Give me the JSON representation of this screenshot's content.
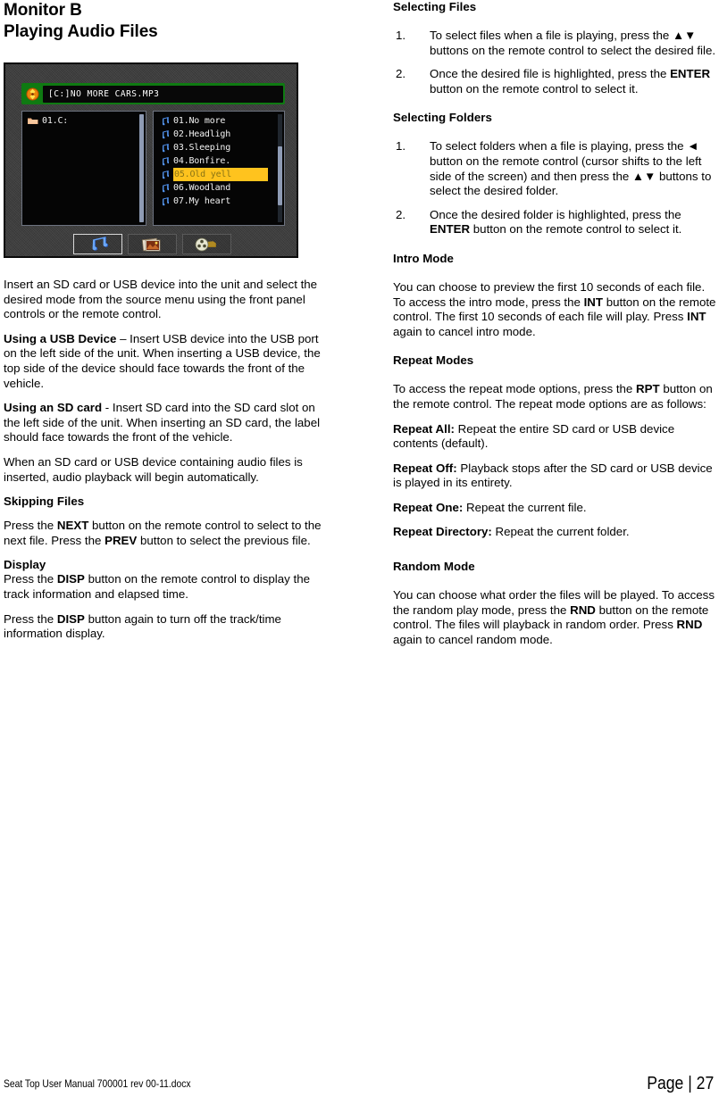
{
  "document": {
    "heading_line1": "Monitor B",
    "heading_line2": "Playing Audio Files"
  },
  "device_screenshot": {
    "now_playing": "[C:]NO MORE CARS.MP3",
    "disc_icon": "disc-icon",
    "folder_pane": {
      "rows": [
        {
          "icon": "folder-icon",
          "label": "01.C:"
        }
      ]
    },
    "file_pane": {
      "rows": [
        {
          "icon": "music-note-icon",
          "label": "01.No more",
          "selected": false
        },
        {
          "icon": "music-note-icon",
          "label": "02.Headligh",
          "selected": false
        },
        {
          "icon": "music-note-icon",
          "label": "03.Sleeping",
          "selected": false
        },
        {
          "icon": "music-note-icon",
          "label": "04.Bonfire.",
          "selected": false
        },
        {
          "icon": "music-note-icon",
          "label": "05.Old yell",
          "selected": true
        },
        {
          "icon": "music-note-icon",
          "label": "06.Woodland",
          "selected": false
        },
        {
          "icon": "music-note-icon",
          "label": "07.My heart",
          "selected": false
        }
      ]
    },
    "mode_buttons": [
      {
        "icon": "music-mode-icon",
        "name": "music-mode",
        "active": true
      },
      {
        "icon": "photo-mode-icon",
        "name": "photo-mode",
        "active": false
      },
      {
        "icon": "video-mode-icon",
        "name": "video-mode",
        "active": false
      }
    ],
    "colors": {
      "title_bar_green": "#0f7a12",
      "selection_yellow": "#ffc31e",
      "panel_background": "#3b3b3b",
      "pane_background": "#050505"
    }
  },
  "left_column": {
    "intro_paragraph": "Insert an SD card or USB device into the unit and select the desired mode from the source menu using the front panel controls or the remote control.",
    "usb_label": "Using a USB Device",
    "usb_text": " – Insert USB device into the USB port on the left side of the unit. When inserting a USB device, the top side of the device should face towards the front of the vehicle.",
    "sd_label": "Using an SD card",
    "sd_text": " - Insert SD card into the SD card slot on the left side of the unit. When inserting an SD card, the label should face towards the front of the vehicle.",
    "auto_play_paragraph": "When an SD card or USB device containing audio files is inserted, audio playback will begin automatically.",
    "skipping_heading": "Skipping Files",
    "skipping_p1_a": "Press the ",
    "skipping_p1_b": "NEXT",
    "skipping_p1_c": " button on the remote control to select to the next file. Press the ",
    "skipping_p1_d": "PREV",
    "skipping_p1_e": " button to select the previous file.",
    "display_heading": "Display",
    "display_p1_a": "Press the ",
    "display_p1_b": "DISP",
    "display_p1_c": " button on the remote control to display the track information and elapsed time.",
    "display_p2_a": "Press the ",
    "display_p2_b": "DISP",
    "display_p2_c": " button again to turn off the track/time information display."
  },
  "right_column": {
    "selecting_files_heading": "Selecting Files",
    "selecting_files_items": [
      {
        "num": "1.",
        "a": "To select files when a file is playing, press the ▲▼ buttons on the remote control to select the desired file.",
        "b": "",
        "c": ""
      },
      {
        "num": "2.",
        "a": "Once the desired file is highlighted, press the ",
        "b": "ENTER",
        "c": " button on the remote control to select it."
      }
    ],
    "selecting_folders_heading": "Selecting Folders",
    "selecting_folders_items": [
      {
        "num": "1.",
        "a": "To select folders when a file is playing, press the ◄ button on the remote control (cursor shifts to the left side of the screen) and then press the ▲▼ buttons to select the desired folder.",
        "b": "",
        "c": ""
      },
      {
        "num": "2.",
        "a": "Once the desired folder is highlighted, press the ",
        "b": "ENTER",
        "c": " button on the remote control to select it."
      }
    ],
    "intro_mode_heading": "Intro Mode",
    "intro_mode_a": "You can choose to preview the first 10 seconds of each file. To access the intro mode, press the ",
    "intro_mode_b": "INT",
    "intro_mode_c": " button on the remote control. The first 10 seconds of each file will play. Press ",
    "intro_mode_d": "INT",
    "intro_mode_e": " again to cancel intro mode.",
    "repeat_modes_heading": "Repeat Modes",
    "repeat_intro_a": "To access the repeat mode options, press the ",
    "repeat_intro_b": "RPT",
    "repeat_intro_c": " button on the remote control. The repeat mode options are as follows:",
    "repeat_all_label": "Repeat All:",
    "repeat_all_text": " Repeat the entire SD card or USB device contents (default).",
    "repeat_off_label": "Repeat Off:",
    "repeat_off_text": " Playback stops after the SD card or USB device is played in its entirety.",
    "repeat_one_label": "Repeat One:",
    "repeat_one_text": " Repeat the current file.",
    "repeat_dir_label": "Repeat Directory:",
    "repeat_dir_text": " Repeat the current folder.",
    "random_mode_heading": "Random Mode",
    "random_mode_a": "You can choose what order the files will be played. To access the random play mode, press the ",
    "random_mode_b": "RND",
    "random_mode_c": " button on the remote control. The files will playback in random order. Press ",
    "random_mode_d": "RND",
    "random_mode_e": " again to cancel random mode."
  },
  "footer": {
    "left": "Seat Top User Manual 700001 rev 00-11.docx",
    "right": "Page | 27"
  }
}
